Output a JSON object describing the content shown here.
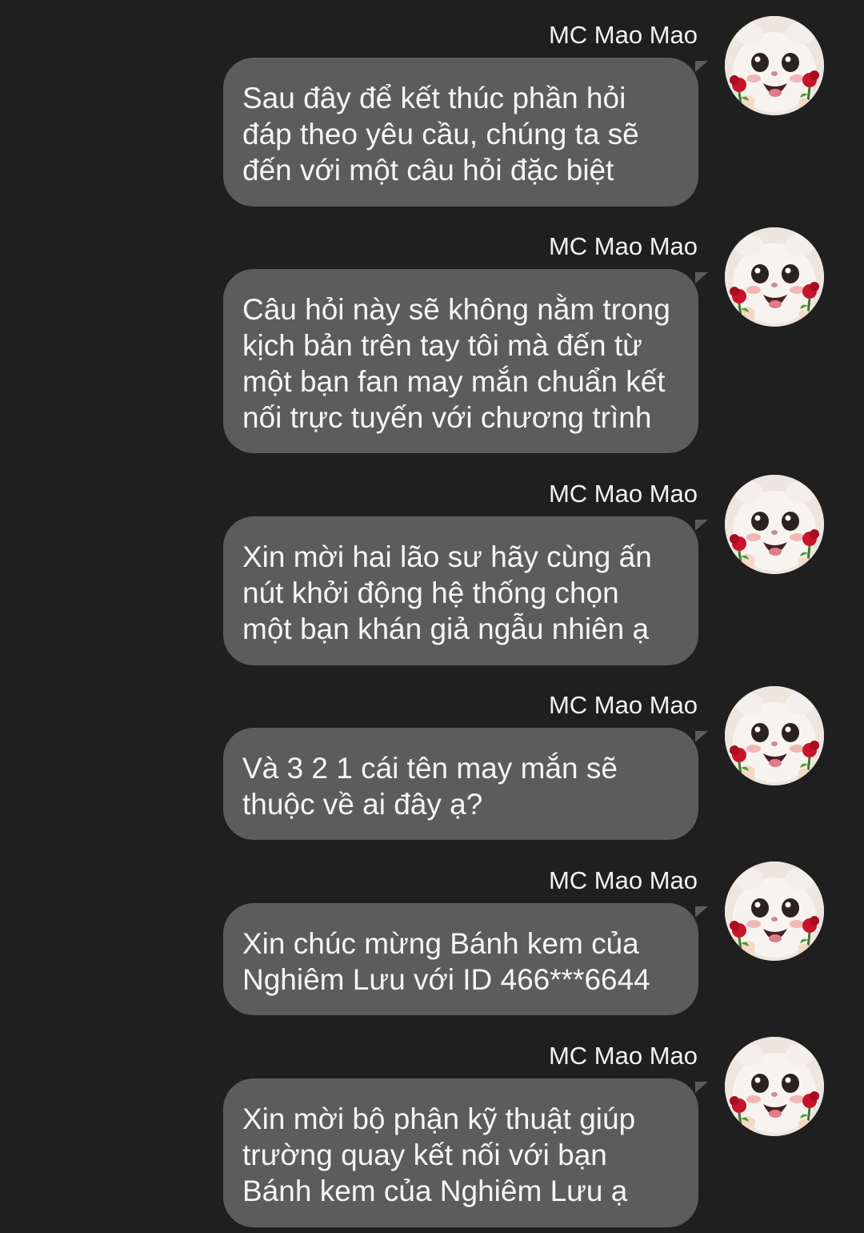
{
  "messages": [
    {
      "sender": "MC Mao Mao",
      "avatar_icon": "cat-with-roses-avatar",
      "text": "Sau đây để kết thúc phần hỏi\nđáp theo yêu cầu, chúng ta sẽ\nđến với một câu hỏi đặc biệt"
    },
    {
      "sender": "MC Mao Mao",
      "avatar_icon": "cat-with-roses-avatar",
      "text": "Câu hỏi này sẽ không nằm trong\nkịch bản trên tay tôi mà đến từ\nmột bạn fan may mắn chuẩn kết\nnối trực tuyến với chương trình"
    },
    {
      "sender": "MC Mao Mao",
      "avatar_icon": "cat-with-roses-avatar",
      "text": "Xin mời hai lão sư hãy cùng ấn\nnút khởi động hệ thống chọn\nmột bạn khán giả ngẫu nhiên ạ"
    },
    {
      "sender": "MC Mao Mao",
      "avatar_icon": "cat-with-roses-avatar",
      "text": "Và 3 2 1 cái tên may mắn sẽ\nthuộc về ai đây ạ?"
    },
    {
      "sender": "MC Mao Mao",
      "avatar_icon": "cat-with-roses-avatar",
      "text": "Xin chúc mừng Bánh kem của\nNghiêm Lưu với ID 466***6644"
    },
    {
      "sender": "MC Mao Mao",
      "avatar_icon": "cat-with-roses-avatar",
      "text": "Xin mời bộ phận kỹ thuật giúp\ntrường quay kết nối với bạn\nBánh kem của Nghiêm Lưu ạ"
    }
  ],
  "colors": {
    "background": "#1f1f1f",
    "bubble": "#5c5c5c",
    "text": "#f5f5f5"
  }
}
